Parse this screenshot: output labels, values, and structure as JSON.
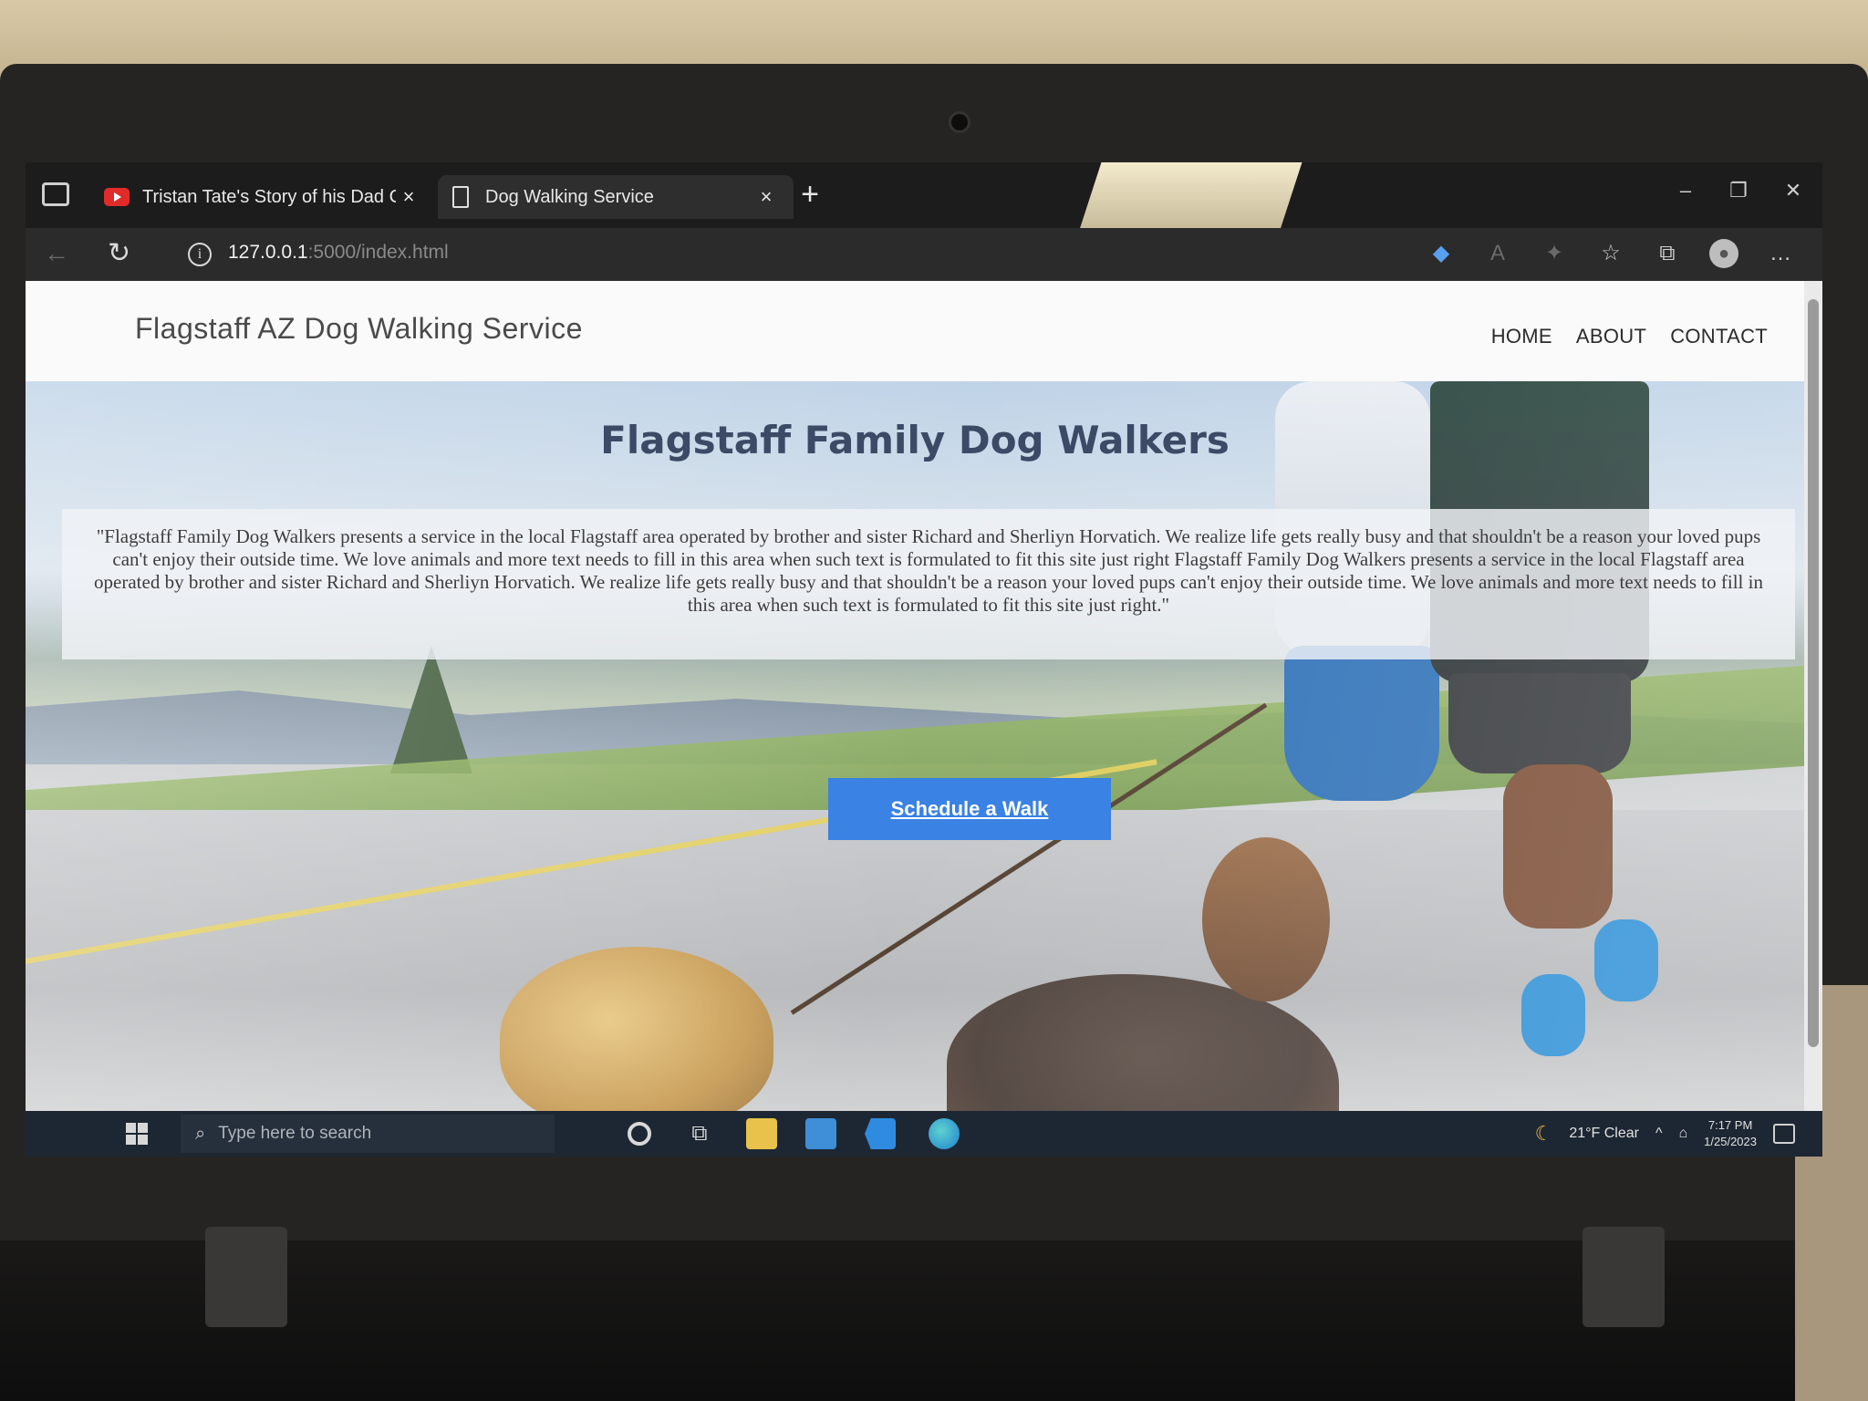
{
  "browser": {
    "tabs": [
      {
        "title": "Tristan Tate's Story of his Dad C",
        "active": false,
        "favicon": "youtube-icon"
      },
      {
        "title": "Dog Walking Service",
        "active": true,
        "favicon": "page-icon"
      }
    ],
    "new_tab": "+",
    "close_glyph": "×",
    "url_host": "127.0.0.1",
    "url_path": ":5000/index.html"
  },
  "site": {
    "brand": "Flagstaff AZ Dog Walking Service",
    "nav": [
      "HOME",
      "ABOUT",
      "CONTACT"
    ],
    "hero": {
      "title": "Flagstaff Family Dog Walkers",
      "text": "\"Flagstaff Family Dog Walkers presents a service in the local Flagstaff area operated by brother and sister Richard and Sherliyn Horvatich. We realize life gets really busy and that shouldn't be a reason your loved pups can't enjoy their outside time. We love animals and more text needs to fill in this area when such text is formulated to fit this site just right Flagstaff Family Dog Walkers presents a service in the local Flagstaff area operated by brother and sister Richard and Sherliyn Horvatich. We realize life gets really busy and that shouldn't be a reason your loved pups can't enjoy their outside time. We love animals and more text needs to fill in this area when such text is formulated to fit this site just right.\"",
      "cta": "Schedule a Walk"
    },
    "colors": {
      "cta": "#3a82e4",
      "title": "#3c4a66"
    }
  },
  "taskbar": {
    "search_placeholder": "Type here to search",
    "weather": "21°F  Clear",
    "time": "7:17 PM",
    "date": "1/25/2023"
  }
}
